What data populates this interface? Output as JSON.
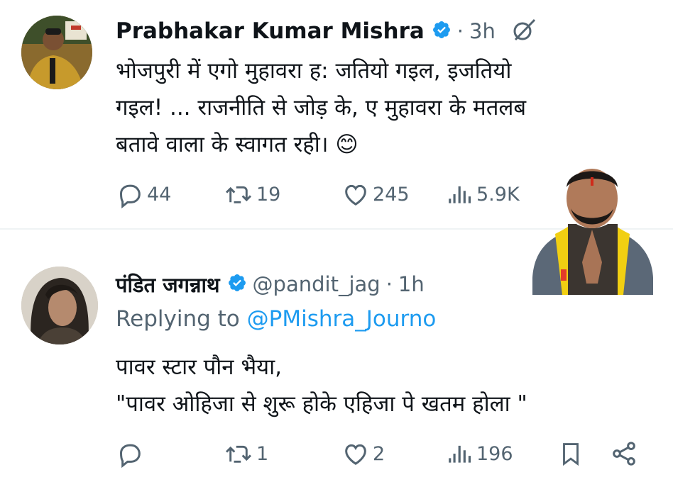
{
  "tweet1": {
    "author_name": "Prabhakar Kumar Mishra",
    "dot": "·",
    "time": "3h",
    "body_lines": [
      "भोजपुरी में एगो मुहावरा ह:  जतियो गइल, इजतियो",
      "गइल! ... राजनीति से जोड़ के, ए मुहावरा के मतलब",
      "बतावे वाला के स्वागत रही। 😊"
    ],
    "replies": "44",
    "reposts": "19",
    "likes": "245",
    "views": "5.9K"
  },
  "tweet2": {
    "author_name": "पंडित जगन्नाथ",
    "handle": "@pandit_jag",
    "dot": "·",
    "time": "1h",
    "replying_label": "Replying to",
    "replying_handle": "@PMishra_Journo",
    "body_lines": [
      "पावर स्टार पौन भैया,",
      "\"पावर ओहिजा से शुरू होके एहिजा पे खतम होला \""
    ],
    "replies": "",
    "reposts": "1",
    "likes": "2",
    "views": "196"
  },
  "colors": {
    "text": "#0f1419",
    "secondary": "#536471",
    "verified": "#1d9bf0",
    "link": "#1d9bf0"
  },
  "icons": [
    "reply-icon",
    "repost-icon",
    "like-icon",
    "views-icon",
    "bookmark-icon",
    "share-icon",
    "verified-badge-icon",
    "grok-icon"
  ]
}
